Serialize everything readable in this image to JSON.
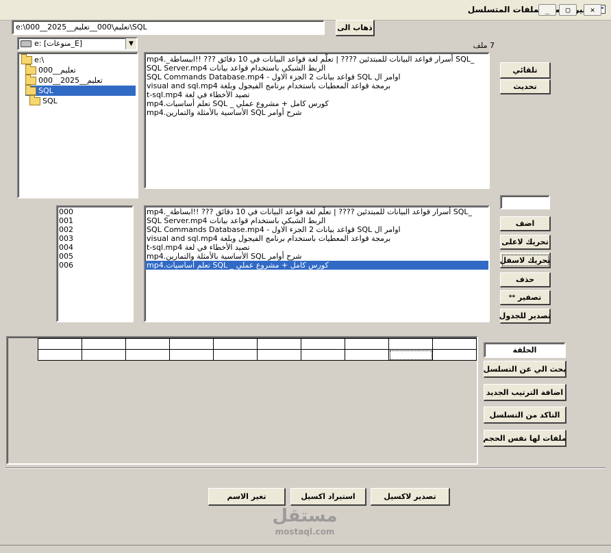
{
  "window": {
    "title": "تغير اسماء الملفات المتسلسل",
    "minimize": "_",
    "maximize": "▢",
    "close": "✕"
  },
  "path": {
    "value": "e:\\000__2025__تعليم\\000__تعليم\\SQL",
    "go_label": "ذهاب الى"
  },
  "drive": {
    "selected": "e: [منوعات_E]",
    "arrow": "▼"
  },
  "tree": [
    {
      "label": "e:\\"
    },
    {
      "label": "000__تعليم"
    },
    {
      "label": "000__2025__تعليم"
    },
    {
      "label": "SQL"
    },
    {
      "label": "SQL"
    }
  ],
  "file_count": "7 ملف",
  "files": [
    "_SQL أسرار قواعد البيانات للمبتدئين ???? | تعلّم لغة قواعد البيانات في 10 دقائق ??? !!اببساطة_.mp4",
    "الربط الشبكي باستخدام قواعد بيانات SQL Server.mp4",
    "اوامر ال SQL قواعد بيانات 2 الجزء الاول - SQL Commands Database.mp4",
    "برمجة قواعد المعطيات باستخدام برنامج الفيجول وبلغة visual and sql.mp4",
    "تصيد الأخطاء في لغة t-sql.mp4",
    "كورس كامل + مشروع عملي _ SQL تعلم أساسيات.mp4",
    "شرح أوامر SQL الأساسية بالأمثلة والتمارين.mp4"
  ],
  "buttons_right": {
    "auto": "تلقائي",
    "refresh": "تحديث",
    "add": "اضف",
    "move_up": "تحريك لاعلى",
    "move_down": "تحريك لاسفل",
    "delete": "حذف",
    "reset": "تصفير",
    "reset_prefix": "**",
    "export_table": "تصدير للجدول"
  },
  "number_input": "",
  "numbers": [
    "000",
    "001",
    "002",
    "003",
    "004",
    "005",
    "006"
  ],
  "order_list": [
    "_SQL أسرار قواعد البيانات للمبتدئين ???? | تعلّم لغة قواعد البيانات في 10 دقائق ??? !!ابساطة_.mp4",
    "الربط الشبكي باستخدام قواعد بيانات SQL Server.mp4",
    "اوامر ال SQL قواعد بيانات 2 الجزء الاول - SQL Commands Database.mp4",
    "برمجة قواعد المعطيات باستخدام برنامج الفيجول وبلغة visual and sql.mp4",
    "تصيد الأخطاء في لغة t-sql.mp4",
    "شرح أوامر SQL الأساسية بالأمثلة والتمارين.mp4",
    "كورس كامل + مشروع عملي _ SQL تعلم أساسيات.mp4"
  ],
  "order_selected_index": 6,
  "side_panel": {
    "loop_field": "الحلقة",
    "search_sequence": "بحث الي عن التسلسل",
    "add_new_order": "اضافة الترتيب الجديد",
    "verify_sequence": "التاكد من التسلسل",
    "same_size_files": "ملفات لها نفس الحجم"
  },
  "bottom": {
    "export_excel": "تصدير لاكسيل",
    "import_excel": "استيراد اكسيل",
    "rename": "تغير الاسم"
  },
  "watermark": {
    "arabic": "مستقل",
    "latin": "mostaql.com"
  },
  "colors": {
    "selection": "#316ac5",
    "face": "#d4d0c8"
  }
}
